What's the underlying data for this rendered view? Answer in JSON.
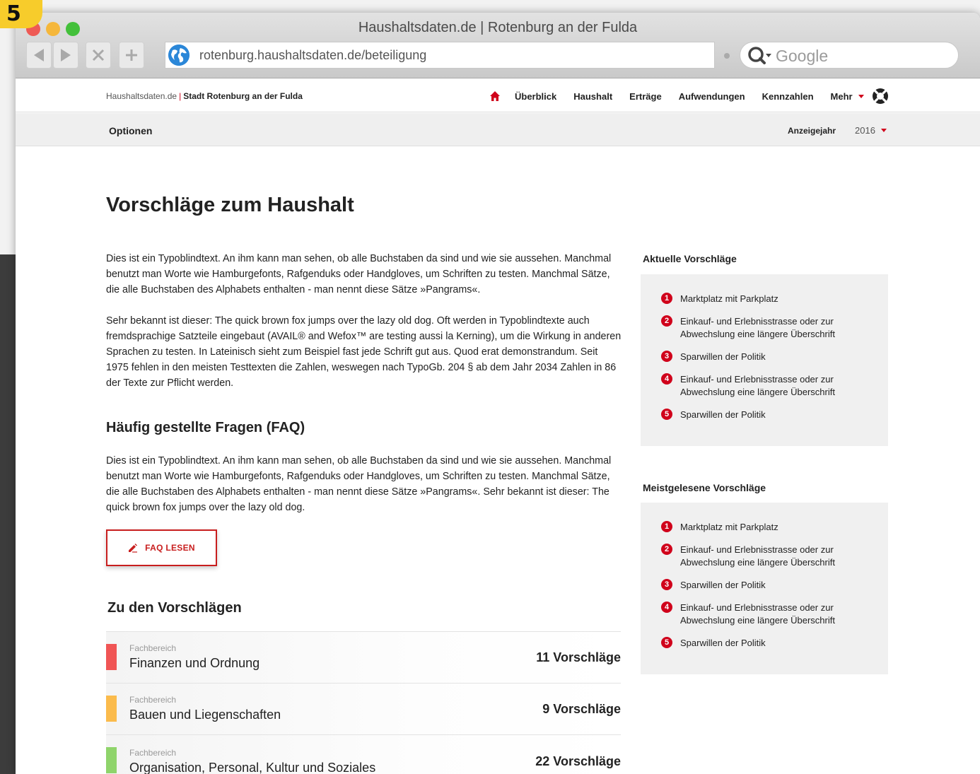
{
  "step_badge": "5",
  "window": {
    "title": "Haushaltsdaten.de | Rotenburg an der Fulda",
    "url": "rotenburg.haushaltsdaten.de/beteiligung",
    "search_placeholder": "Google"
  },
  "header": {
    "brand_site": "Haushaltsdaten.de",
    "brand_separator": "|",
    "brand_city": "Stadt Rotenburg an der Fulda",
    "nav": [
      "Überblick",
      "Haushalt",
      "Erträge",
      "Aufwendungen",
      "Kennzahlen"
    ],
    "more_label": "Mehr",
    "accent_color": "#d0021b"
  },
  "options_bar": {
    "label": "Optionen",
    "year_label": "Anzeigejahr",
    "year_value": "2016"
  },
  "main": {
    "title": "Vorschläge zum Haushalt",
    "intro_p1": "Dies ist ein Typoblindtext. An ihm kann man sehen, ob alle Buchstaben da sind und wie sie aussehen. Manchmal benutzt man Worte wie Hamburgefonts, Rafgenduks oder Handgloves, um Schriften zu testen. Manchmal Sätze, die alle Buchstaben des Alphabets enthalten - man nennt diese Sätze »Pangrams«.",
    "intro_p2": "Sehr bekannt ist dieser: The quick brown fox jumps over the lazy old dog. Oft werden in Typoblindtexte auch fremdsprachige Satzteile eingebaut (AVAIL® and Wefox™ are testing aussi la Kerning), um die Wirkung in anderen Sprachen zu testen. In Lateinisch sieht zum Beispiel fast jede Schrift gut aus. Quod erat demonstrandum. Seit 1975 fehlen in den meisten Testtexten die Zahlen, weswegen nach TypoGb. 204 § ab dem Jahr 2034 Zahlen in 86 der Texte zur Pflicht werden.",
    "faq_title": "Häufig gestellte Fragen (FAQ)",
    "faq_text": "Dies ist ein Typoblindtext. An ihm kann man sehen, ob alle Buchstaben da sind und wie sie aussehen. Manchmal benutzt man Worte wie Hamburgefonts, Rafgenduks oder Handgloves, um Schriften zu testen. Manchmal Sätze, die alle Buchstaben des Alphabets enthalten - man nennt diese Sätze »Pangrams«. Sehr bekannt ist dieser: The quick brown fox jumps over the lazy old dog.",
    "faq_button": "FAQ LESEN",
    "proposals_title": "Zu den Vorschlägen",
    "categories": [
      {
        "small": "Fachbereich",
        "name": "Finanzen und Ordnung",
        "count": "11 Vorschläge",
        "color": "#f05555"
      },
      {
        "small": "Fachbereich",
        "name": "Bauen und Liegenschaften",
        "count": "9 Vorschläge",
        "color": "#fbbb4c"
      },
      {
        "small": "Fachbereich",
        "name": "Organisation, Personal, Kultur und Soziales",
        "count": "22 Vorschläge",
        "color": "#8fd46b"
      }
    ]
  },
  "sidebar": {
    "current_title": "Aktuelle Vorschläge",
    "current": [
      {
        "num": "1",
        "text": "Marktplatz mit Parkplatz"
      },
      {
        "num": "2",
        "text": "Einkauf- und Erlebnisstrasse oder zur Abwechslung eine längere Überschrift"
      },
      {
        "num": "3",
        "text": "Sparwillen der Politik"
      },
      {
        "num": "4",
        "text": "Einkauf- und Erlebnisstrasse oder zur Abwechslung eine längere Überschrift"
      },
      {
        "num": "5",
        "text": "Sparwillen der Politik"
      }
    ],
    "popular_title": "Meistgelesene Vorschläge",
    "popular": [
      {
        "num": "1",
        "text": "Marktplatz mit Parkplatz"
      },
      {
        "num": "2",
        "text": "Einkauf- und Erlebnisstrasse oder zur Abwechslung eine längere Überschrift"
      },
      {
        "num": "3",
        "text": "Sparwillen der Politik"
      },
      {
        "num": "4",
        "text": "Einkauf- und Erlebnisstrasse oder zur Abwechslung eine längere Überschrift"
      },
      {
        "num": "5",
        "text": "Sparwillen der Politik"
      }
    ]
  }
}
